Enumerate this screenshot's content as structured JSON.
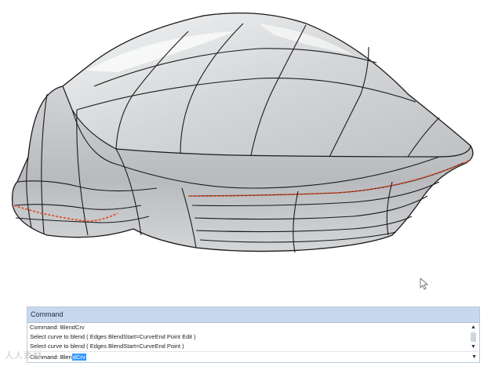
{
  "viewport": {
    "model": "surface-model"
  },
  "command_panel": {
    "title": "Command",
    "history": [
      "Command: BlendCrv",
      "Select curve to blend ( Edges  BlendStart=CurveEnd  Point  Edit )",
      "Select curve to blend ( Edges  BlendStart=CurveEnd  Point )"
    ],
    "prompt_prefix": "Command: Blen",
    "prompt_selected": "dCrv",
    "scroll_up": "▲",
    "scroll_down": "▼",
    "dropdown": "▼"
  },
  "watermark": "人人素材",
  "colors": {
    "surface": "#c9cbce",
    "highlight": "#f2f3f4",
    "isocurve": "#1b1b1b",
    "edge_highlight": "#e0431a",
    "panel_title_bg": "#c7d8ee",
    "selection": "#3399ff"
  }
}
